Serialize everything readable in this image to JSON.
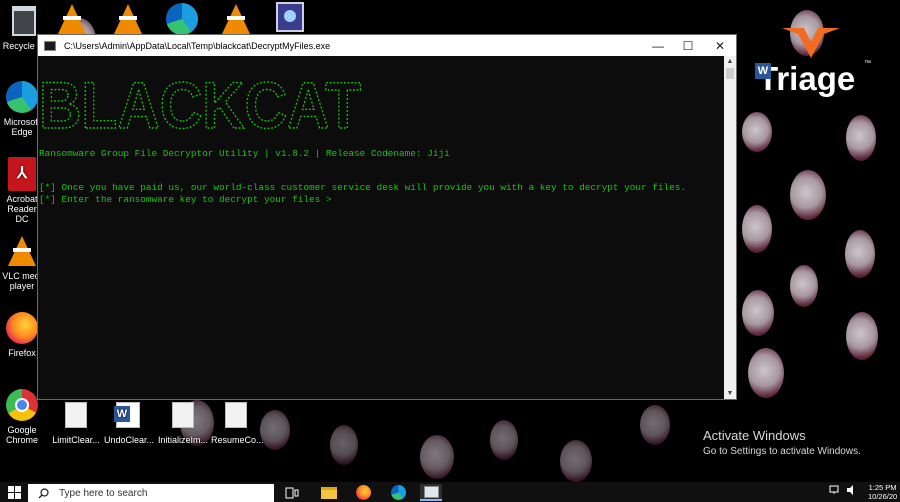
{
  "desktop": {
    "icons": [
      {
        "label": "Recycle Bi",
        "icon": "recycle-bin-icon"
      },
      {
        "label": "Microsoft\nEdge",
        "icon": "edge-icon"
      },
      {
        "label": "Acrobat\nReader DC",
        "icon": "acrobat-icon"
      },
      {
        "label": "VLC medi\nplayer",
        "icon": "vlc-icon"
      },
      {
        "label": "Firefox",
        "icon": "firefox-icon"
      },
      {
        "label": "Google\nChrome",
        "icon": "chrome-icon"
      },
      {
        "label": "LimitClear...",
        "icon": "document-icon"
      },
      {
        "label": "UndoClear...",
        "icon": "word-document-icon"
      },
      {
        "label": "InitializeIm...",
        "icon": "document-icon"
      },
      {
        "label": "ResumeCo...",
        "icon": "document-icon"
      }
    ]
  },
  "watermark": {
    "brand": "Triage",
    "trademark": "™",
    "accent": "#f26b21"
  },
  "window": {
    "title": "C:\\Users\\Admin\\AppData\\Local\\Temp\\blackcat\\DecryptMyFiles.exe",
    "minimize": "—",
    "maximize": "☐",
    "close": "✕"
  },
  "console": {
    "banner_text": "BLACKCAT",
    "lines": [
      "Ransomware Group File Decryptor Utility | v1.8.2 | Release Codename: Jiji",
      "[*] Once you have paid us, our world-class customer service desk will provide you with a key to decrypt your files.",
      "[*] Enter the ransomware key to decrypt your files >"
    ],
    "text_color": "#16c60c"
  },
  "activation": {
    "title": "Activate Windows",
    "subtitle": "Go to Settings to activate Windows."
  },
  "taskbar": {
    "search_placeholder": "Type here to search",
    "time": "1:25 PM",
    "date": "10/26/20"
  }
}
